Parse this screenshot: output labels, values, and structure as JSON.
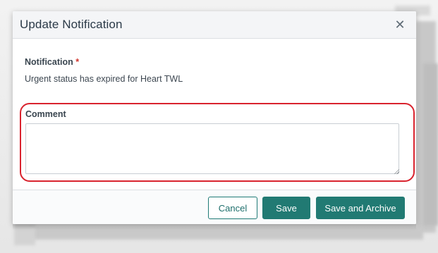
{
  "dialog": {
    "title": "Update Notification",
    "close_icon": "close-icon"
  },
  "notification": {
    "label": "Notification",
    "required_marker": "*",
    "value": "Urgent status has expired for Heart TWL"
  },
  "comment": {
    "label": "Comment",
    "value": "",
    "placeholder": "",
    "highlight_color": "#d9232e"
  },
  "footer": {
    "cancel_label": "Cancel",
    "save_label": "Save",
    "save_archive_label": "Save and Archive",
    "accent_color": "#217a73"
  }
}
